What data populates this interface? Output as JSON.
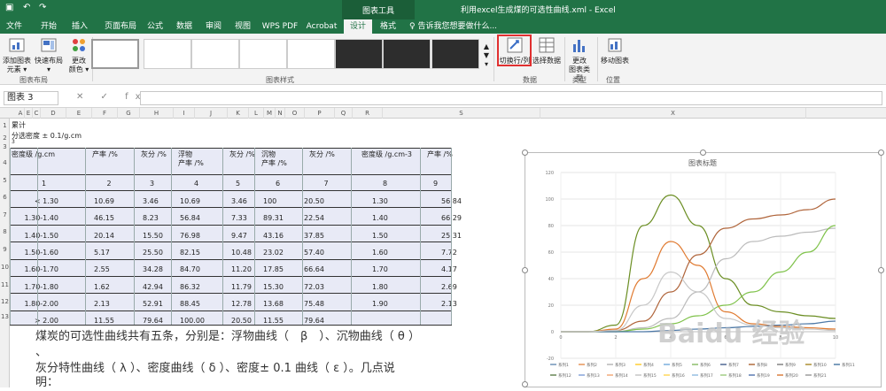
{
  "app": {
    "chart_tools_label": "图表工具",
    "window_title": "利用excel生成煤的可选性曲线.xml - Excel"
  },
  "ribbon_tabs": [
    "文件",
    "开始",
    "插入",
    "页面布局",
    "公式",
    "数据",
    "审阅",
    "视图",
    "WPS PDF",
    "Acrobat",
    "设计",
    "格式"
  ],
  "tell_me": "告诉我您想要做什么...",
  "ribbon": {
    "add_element": "添加图表\n元素 ▾",
    "quick_layout": "快速布局\n▾",
    "change_colors": "更改\n颜色 ▾",
    "switch_row_col": "切换行/列",
    "select_data": "选择数据",
    "change_type": "更改\n图表类型",
    "move_chart": "移动图表",
    "groups": {
      "layouts": "图表布局",
      "styles": "图表样式",
      "data": "数据",
      "type": "类型",
      "location": "位置"
    }
  },
  "formula_bar": {
    "name_box": "图表 3",
    "fx_icons": "✕ ✓ fx",
    "formula": ""
  },
  "columns": [
    "A",
    "E",
    "C",
    "D",
    "E",
    "F",
    "G",
    "H",
    "I",
    "J",
    "K",
    "L",
    "M",
    "N",
    "O",
    "P",
    "Q",
    "R",
    "S",
    "X"
  ],
  "rows": [
    "1",
    "2",
    "3",
    "4",
    "5",
    "6",
    "7",
    "8",
    "9",
    "10",
    "11",
    "12",
    "13"
  ],
  "sheet": {
    "title1": "累计",
    "title2": "分选密度  ± 0.1/g.cm",
    "title2_sup": "3",
    "headers": [
      "密度级 /g.cm",
      "产率 /%",
      "灰分 /%",
      "浮物\n产率 /%",
      "灰分 /%",
      "沉物\n产率 /%",
      "灰分 /%",
      "密度级 /g.cm-3",
      "产率 /%"
    ],
    "indices": [
      "1",
      "2",
      "3",
      "4",
      "5",
      "6",
      "7",
      "8",
      "9"
    ],
    "rows": [
      [
        "< 1.30",
        "10.69",
        "3.46",
        "10.69",
        "3.46",
        "100",
        "20.50",
        "1.30",
        "56.84"
      ],
      [
        "1.30-1.40",
        "46.15",
        "8.23",
        "56.84",
        "7.33",
        "89.31",
        "22.54",
        "1.40",
        "66.29"
      ],
      [
        "1.40-1.50",
        "20.14",
        "15.50",
        "76.98",
        "9.47",
        "43.16",
        "37.85",
        "1.50",
        "25.31"
      ],
      [
        "1.50-1.60",
        "5.17",
        "25.50",
        "82.15",
        "10.48",
        "23.02",
        "57.40",
        "1.60",
        "7.72"
      ],
      [
        "1.60-1.70",
        "2.55",
        "34.28",
        "84.70",
        "11.20",
        "17.85",
        "66.64",
        "1.70",
        "4.17"
      ],
      [
        "1.70-1.80",
        "1.62",
        "42.94",
        "86.32",
        "11.79",
        "15.30",
        "72.03",
        "1.80",
        "2.69"
      ],
      [
        "1.80-2.00",
        "2.13",
        "52.91",
        "88.45",
        "12.78",
        "13.68",
        "75.48",
        "1.90",
        "2.13"
      ],
      [
        "> 2.00",
        "11.55",
        "79.64",
        "100.00",
        "20.50",
        "11.55",
        "79.64",
        "",
        ""
      ]
    ]
  },
  "notes": {
    "line1": "煤炭的可选性曲线共有五条，分别是：浮物曲线（　β　）、沉物曲线（ θ ）",
    "line1b": "、",
    "line2": "灰分特性曲线（ λ ）、密度曲线（ δ ）、密度± 0.1 曲线（ ε ）。几点说",
    "line3": "明："
  },
  "watermark": "Baidu 经验",
  "chart_data": {
    "type": "line",
    "title": "图表标题",
    "ylim": [
      -20,
      120
    ],
    "yticks": [
      "-20",
      "0",
      "20",
      "40",
      "60",
      "80",
      "100",
      "120"
    ],
    "xticks": [
      "0",
      "2",
      "4",
      "6",
      "8",
      "10"
    ],
    "legend_position": "bottom",
    "legend": [
      "系列1",
      "系列2",
      "系列3",
      "系列4",
      "系列5",
      "系列6",
      "系列7",
      "系列8",
      "系列9",
      "系列10",
      "系列11",
      "系列12",
      "系列13",
      "系列14",
      "系列15",
      "系列16",
      "系列17",
      "系列18",
      "系列19",
      "系列20",
      "系列21"
    ],
    "series": [
      {
        "color": "#6b8e23",
        "x": [
          0,
          1,
          2,
          3,
          4,
          5,
          6,
          7,
          8,
          9,
          10
        ],
        "values": [
          0,
          0,
          5,
          80,
          103,
          80,
          40,
          20,
          15,
          12,
          10
        ]
      },
      {
        "color": "#e07a30",
        "x": [
          0,
          1,
          2,
          3,
          4,
          5,
          6,
          7,
          8,
          9,
          10
        ],
        "values": [
          0,
          0,
          2,
          40,
          68,
          50,
          15,
          6,
          4,
          3,
          2
        ]
      },
      {
        "color": "#b0653b",
        "x": [
          0,
          1,
          2,
          3,
          4,
          5,
          6,
          7,
          8,
          9,
          10
        ],
        "values": [
          0,
          0,
          1,
          8,
          30,
          58,
          78,
          85,
          88,
          92,
          100
        ]
      },
      {
        "color": "#bbbbbb",
        "x": [
          0,
          1,
          2,
          3,
          4,
          5,
          6,
          7,
          8,
          9,
          10
        ],
        "values": [
          0,
          0,
          0,
          3,
          10,
          30,
          55,
          68,
          72,
          75,
          78
        ]
      },
      {
        "color": "#7fc24a",
        "x": [
          0,
          1,
          2,
          3,
          4,
          5,
          6,
          7,
          8,
          9,
          10
        ],
        "values": [
          0,
          0,
          0,
          2,
          6,
          12,
          20,
          30,
          45,
          60,
          80
        ]
      },
      {
        "color": "#4e79a7",
        "x": [
          0,
          1,
          2,
          3,
          4,
          5,
          6,
          7,
          8,
          9,
          10
        ],
        "values": [
          0,
          0,
          0,
          0,
          1,
          2,
          3,
          4,
          5,
          6,
          8
        ]
      },
      {
        "color": "#c8c8c8",
        "x": [
          0,
          1,
          2,
          3,
          4,
          5,
          6,
          7,
          8,
          9,
          10
        ],
        "values": [
          0,
          0,
          1,
          20,
          45,
          30,
          10,
          5,
          3,
          2,
          1
        ]
      }
    ]
  }
}
